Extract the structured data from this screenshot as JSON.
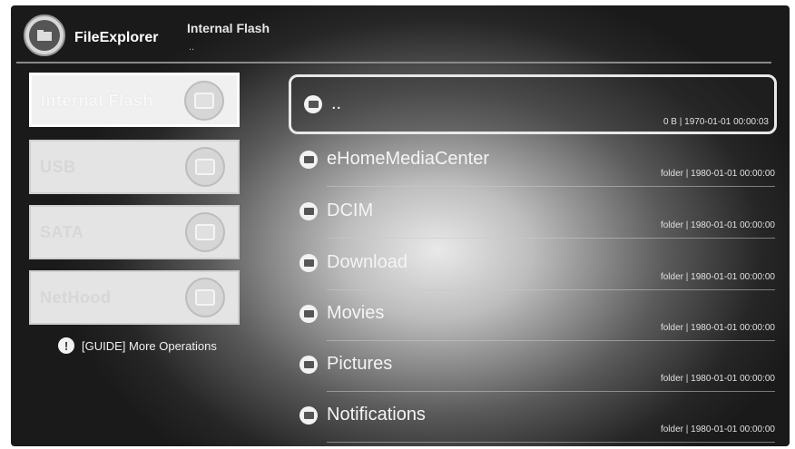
{
  "app": {
    "title": "FileExplorer"
  },
  "header": {
    "location": "Internal Flash",
    "path": ".."
  },
  "storage": [
    {
      "label": "Internal Flash",
      "icon": "internal-flash-icon",
      "selected": true
    },
    {
      "label": "USB",
      "icon": "usb-icon",
      "selected": false
    },
    {
      "label": "SATA",
      "icon": "sata-icon",
      "selected": false
    },
    {
      "label": "NetHood",
      "icon": "nethood-icon",
      "selected": false
    }
  ],
  "guide": {
    "icon": "info-icon",
    "text": "[GUIDE] More Operations"
  },
  "files": [
    {
      "name": "..",
      "meta": "0 B | 1970-01-01 00:00:03",
      "selected": true
    },
    {
      "name": "eHomeMediaCenter",
      "meta": "folder | 1980-01-01 00:00:00"
    },
    {
      "name": "DCIM",
      "meta": "folder | 1980-01-01 00:00:00"
    },
    {
      "name": "Download",
      "meta": "folder | 1980-01-01 00:00:00"
    },
    {
      "name": "Movies",
      "meta": "folder | 1980-01-01 00:00:00"
    },
    {
      "name": "Pictures",
      "meta": "folder | 1980-01-01 00:00:00"
    },
    {
      "name": "Notifications",
      "meta": "folder | 1980-01-01 00:00:00"
    }
  ]
}
